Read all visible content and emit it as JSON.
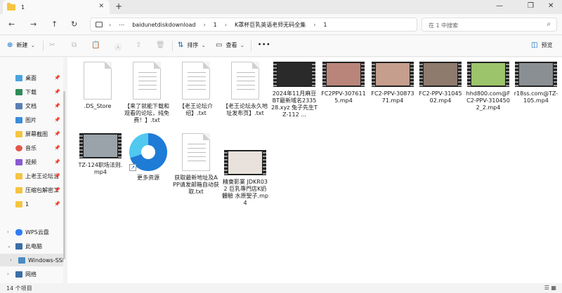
{
  "window": {
    "tab_title": "1",
    "close_glyph": "✕",
    "new_tab_glyph": "+",
    "minimize_glyph": "—",
    "maximize_glyph": "❐",
    "close_window_glyph": "✕"
  },
  "nav_buttons": {
    "back": "←",
    "forward": "→",
    "up": "↑",
    "refresh": "↻"
  },
  "address": {
    "more": "⋯",
    "crumbs": [
      "baidunetdiskdownload",
      "1",
      "K罩杯巨乳英语老师无码全集",
      "1"
    ]
  },
  "search": {
    "placeholder": "在 1 中搜索",
    "icon": "⌕"
  },
  "toolbar": {
    "new_label": "新建",
    "new_icon": "⊕",
    "sort_label": "排序",
    "sort_icon": "⇅",
    "view_label": "查看",
    "view_icon": "▭",
    "more_label": "•••",
    "preview_label": "预览",
    "preview_icon": "◫",
    "cut_icon": "✂",
    "copy_icon": "⧉",
    "paste_icon": "📋",
    "rename_icon": "Ⓐ",
    "share_icon": "⇪",
    "delete_icon": "🗑"
  },
  "sidebar": {
    "quick_access": [
      {
        "label": "桌面",
        "color": "#4aa3df"
      },
      {
        "label": "下载",
        "color": "#2e8b57"
      },
      {
        "label": "文档",
        "color": "#5b7fb5"
      },
      {
        "label": "图片",
        "color": "#3c8dd9"
      },
      {
        "label": "屏幕截图",
        "color": "#f4c542"
      },
      {
        "label": "音乐",
        "color": "#e2574c"
      },
      {
        "label": "视频",
        "color": "#8a5ad0"
      },
      {
        "label": "上老王论坛当",
        "color": "#f4c542"
      },
      {
        "label": "压缩包解密工",
        "color": "#f4c542"
      },
      {
        "label": "1",
        "color": "#f4c542"
      }
    ],
    "tree": [
      {
        "label": "WPS云盘",
        "color": "#2f7cf6"
      },
      {
        "label": "此电脑",
        "color": "#3a6ea5"
      },
      {
        "label": "Windows-SSD",
        "color": "#4a8bc2"
      },
      {
        "label": "网络",
        "color": "#3a6ea5"
      }
    ],
    "pin_glyph": "📌",
    "chevron_closed": "›",
    "chevron_open": "⌄"
  },
  "files": [
    {
      "name": ".DS_Store",
      "type": "doc"
    },
    {
      "name": "【来了就能下载和观看的论坛，纯免费！】.txt",
      "type": "doc"
    },
    {
      "name": "【老王论坛介绍】.txt",
      "type": "doc"
    },
    {
      "name": "【老王论坛永久地址发布页】.txt",
      "type": "doc"
    },
    {
      "name": "2024年11月麻豆BT最新域名233528.xyz 兔子先生TZ-112 ...",
      "type": "video",
      "frame_color": "#2a2a2a"
    },
    {
      "name": "FC2PPV-3076115.mp4",
      "type": "video",
      "frame_color": "#b9857a"
    },
    {
      "name": "FC2-PPV-3087371.mp4",
      "type": "video",
      "frame_color": "#c69e8e"
    },
    {
      "name": "FC2-PPV-3104502.mp4",
      "type": "video",
      "frame_color": "#8f7a6e"
    },
    {
      "name": "hhd800.com@FC2-PPV-3104502_2.mp4",
      "type": "video",
      "frame_color": "#9cc46a"
    },
    {
      "name": "r18ss.com@TZ-105.mp4",
      "type": "video",
      "frame_color": "#8a8f94"
    },
    {
      "name": "TZ-124职场法则.mp4",
      "type": "video",
      "frame_color": "#9aa3a9"
    },
    {
      "name": "更多资源",
      "type": "shortcut",
      "shortcut_glyph": "↗"
    },
    {
      "name": "获取最新地址及APP请发邮箱自动获取.txt",
      "type": "doc"
    },
    {
      "name": "精東影業 JDKR032 巨乳專門店K奶體驗 水原聖子.mp4",
      "type": "video",
      "frame_color": "#e9e2dc"
    }
  ],
  "status": {
    "count": "14 个项目",
    "view_icons": "☰ ▦"
  }
}
